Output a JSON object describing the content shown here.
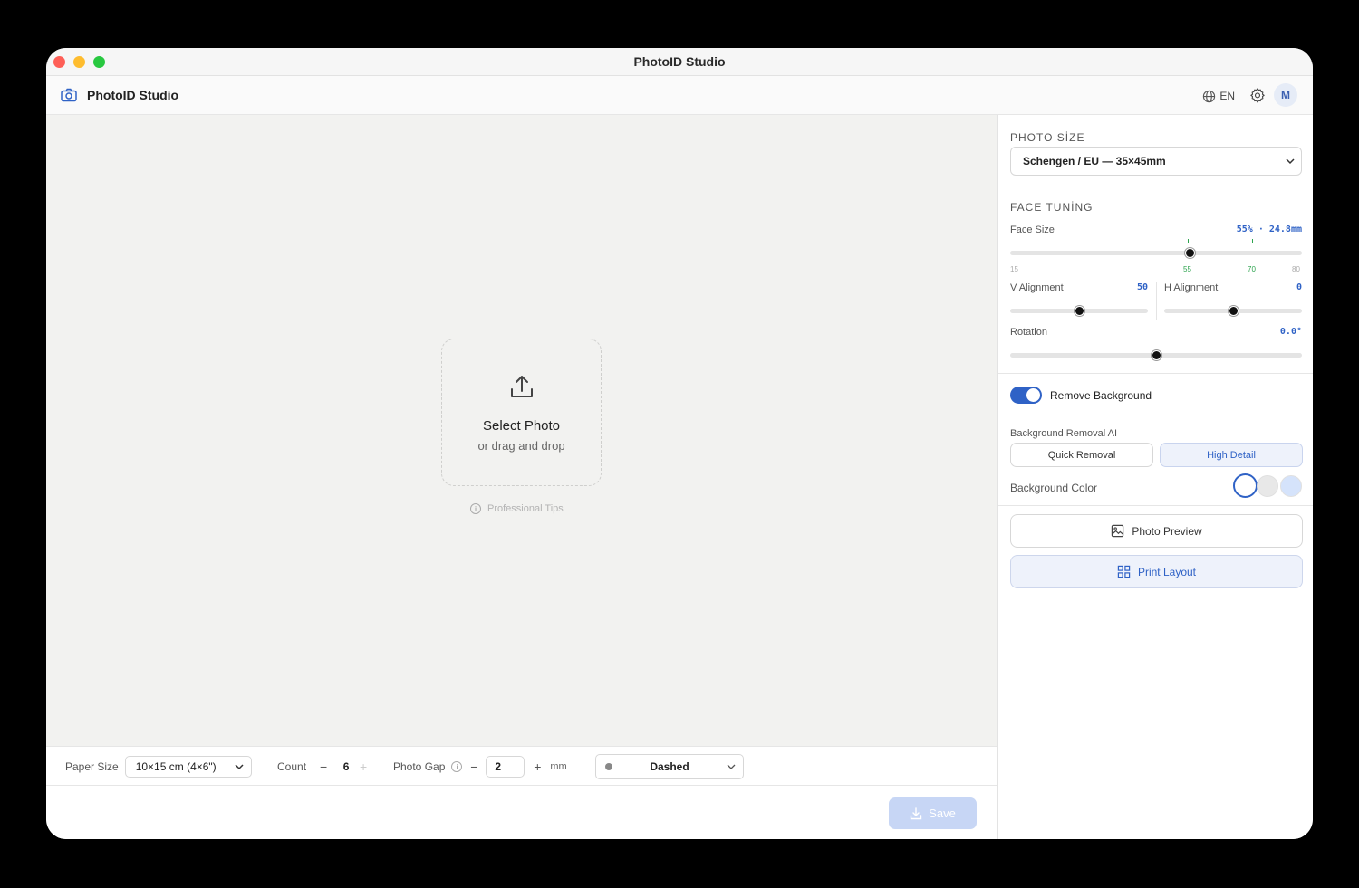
{
  "window": {
    "title": "PhotoID Studio"
  },
  "appbar": {
    "app_name": "PhotoID Studio",
    "language": "EN",
    "avatar_initial": "M"
  },
  "dropzone": {
    "title": "Select Photo",
    "subtitle": "or drag and drop",
    "tips": "Professional Tips"
  },
  "bottombar": {
    "paper_size_label": "Paper Size",
    "paper_size_value": "10×15 cm (4×6\")",
    "count_label": "Count",
    "count_value": "6",
    "photo_gap_label": "Photo Gap",
    "photo_gap_value": "2",
    "gap_unit": "mm",
    "cut_line_style": "Dashed",
    "decrement": "−",
    "increment": "+"
  },
  "footer": {
    "save_label": "Save"
  },
  "panel": {
    "photo_size": {
      "title": "PHOTO SİZE",
      "value": "Schengen / EU — 35×45mm"
    },
    "face_tuning": {
      "title": "FACE TUNİNG",
      "face_size": {
        "label": "Face Size",
        "value": "55% · 24.8mm",
        "level": 55,
        "min": "15",
        "marker_low": "55",
        "marker_high": "70",
        "max": "80"
      },
      "v_alignment": {
        "label": "V Alignment",
        "value": "50",
        "level": 50
      },
      "h_alignment": {
        "label": "H Alignment",
        "value": "0",
        "level": 50
      },
      "rotation": {
        "label": "Rotation",
        "value": "0.0°",
        "level": 50
      }
    },
    "background": {
      "remove_label": "Remove Background",
      "remove_enabled": true,
      "ai_label": "Background Removal AI",
      "quick_label": "Quick Removal",
      "high_label": "High Detail",
      "selected_mode": "High Detail",
      "color_label": "Background Color",
      "colors": [
        "#ffffff",
        "#e8e8e8",
        "#d5e3fb"
      ],
      "selected_color": "#ffffff"
    },
    "photo_preview_label": "Photo Preview",
    "print_layout_label": "Print Layout"
  },
  "colors": {
    "accent": "#2f62c6",
    "marker_green": "#2ea44f"
  }
}
